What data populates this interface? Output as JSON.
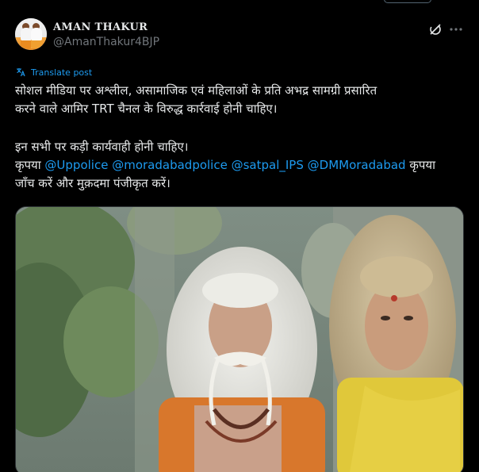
{
  "author": {
    "display_name": "AMAN THAKUR",
    "handle": "@AmanThakur4BJP"
  },
  "icons": {
    "grok": "grok-icon",
    "more": "more-icon",
    "translate": "translate-icon"
  },
  "translate_label": "Translate post",
  "post": {
    "line1": "सोशल मीडिया पर अश्लील, असामाजिक एवं महिलाओं के प्रति अभद्र सामग्री प्रसारित",
    "line2": "करने वाले आमिर TRT चैनल के विरुद्ध कार्रवाई होनी चाहिए।",
    "line3": "इन सभी पर कड़ी कार्यवाही होनी चाहिए।",
    "line4_prefix": "कृपया",
    "mentions": [
      "@Uppolice",
      "@moradabadpolice",
      "@satpal_IPS",
      "@DMMoradabad"
    ],
    "line4_suffix": "कृपया",
    "line5": "जाँच करें और मुक़दमा पंजीकृत करें।"
  },
  "colors": {
    "background": "#000000",
    "text": "#e7e9ea",
    "secondary": "#71767b",
    "accent": "#1d9bf0",
    "border": "#2f3336"
  }
}
